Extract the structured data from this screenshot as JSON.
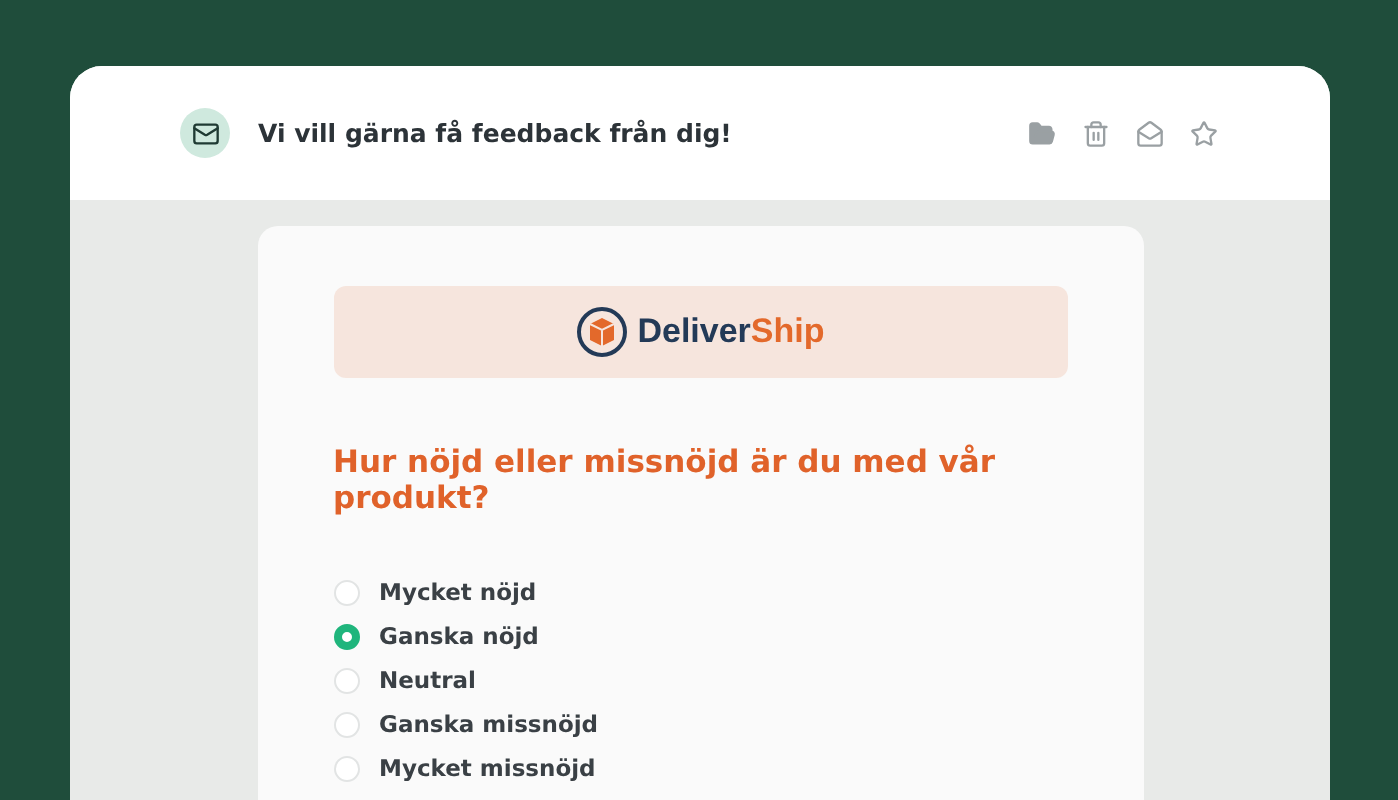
{
  "email": {
    "subject": "Vi vill gärna få feedback från dig!"
  },
  "logo": {
    "text_primary": "Deliver",
    "text_accent": "Ship"
  },
  "question": "Hur nöjd eller missnöjd är du med vår produkt?",
  "options": [
    {
      "label": "Mycket nöjd",
      "selected": false
    },
    {
      "label": "Ganska nöjd",
      "selected": true
    },
    {
      "label": "Neutral",
      "selected": false
    },
    {
      "label": "Ganska missnöjd",
      "selected": false
    },
    {
      "label": "Mycket missnöjd",
      "selected": false
    }
  ]
}
